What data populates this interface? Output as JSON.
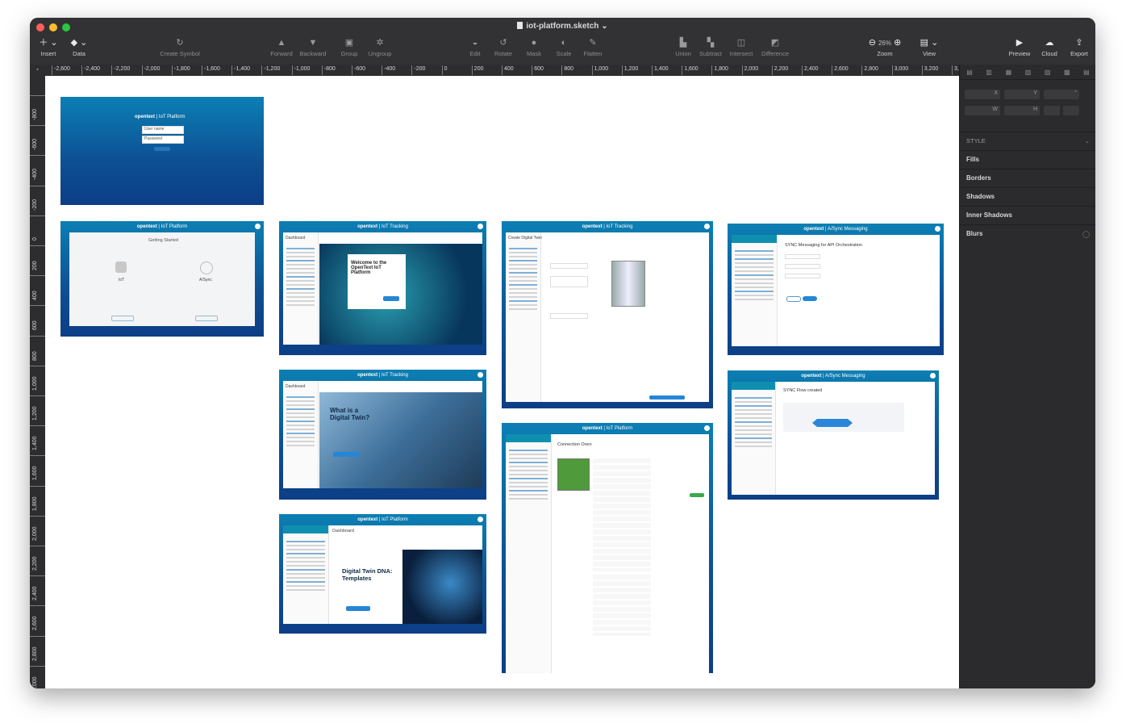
{
  "window": {
    "title": "iot-platform.sketch",
    "title_chevron": "⌄"
  },
  "toolbar": {
    "insert": "Insert",
    "data": "Data",
    "create_symbol": "Create Symbol",
    "forward": "Forward",
    "backward": "Backward",
    "group": "Group",
    "ungroup": "Ungroup",
    "edit": "Edit",
    "rotate": "Rotate",
    "mask": "Mask",
    "scale": "Scale",
    "flatten": "Flatten",
    "union": "Union",
    "subtract": "Subtract",
    "intersect": "Intersect",
    "difference": "Difference",
    "zoom": "Zoom",
    "zoom_value": "26%",
    "view": "View",
    "preview": "Preview",
    "cloud": "Cloud",
    "export": "Export"
  },
  "ruler": {
    "h_ticks": [
      "-2,600",
      "-2,400",
      "-2,200",
      "-2,000",
      "-1,800",
      "-1,600",
      "-1,400",
      "-1,200",
      "-1,000",
      "-800",
      "-600",
      "-400",
      "-200",
      "0",
      "200",
      "400",
      "600",
      "800",
      "1,000",
      "1,200",
      "1,400",
      "1,600",
      "1,800",
      "2,000",
      "2,200",
      "2,400",
      "2,600",
      "2,800",
      "3,000",
      "3,200",
      "3,40"
    ],
    "v_ticks": [
      "-800",
      "-600",
      "-400",
      "-200",
      "0",
      "200",
      "400",
      "600",
      "800",
      "1,000",
      "1,200",
      "1,400",
      "1,600",
      "1,800",
      "2,000",
      "2,200",
      "2,400",
      "2,600",
      "2,800",
      "3,000"
    ]
  },
  "inspector": {
    "x": "X",
    "y": "Y",
    "r": "°",
    "w": "W",
    "h": "H",
    "style": "STYLE",
    "fills": "Fills",
    "borders": "Borders",
    "shadows": "Shadows",
    "inner_shadows": "Inner Shadows",
    "blurs": "Blurs"
  },
  "artboards": {
    "brand": "opentext",
    "iot_platform": "IoT Platform",
    "iot_tracking": "IoT Tracking",
    "async_messaging": "A/Sync Messaging",
    "login": {
      "user": "User name",
      "password": "Password"
    },
    "getting_started": {
      "title": "Getting Started",
      "iot": "IoT",
      "async": "A/Sync"
    },
    "dashboard": "Dashboard",
    "welcome": "Welcome to the OpenText IoT Platform",
    "digital_twin": "What is a Digital Twin?",
    "dna": "Digital Twin DNA: Templates",
    "create_twin": "Create Digital Twin",
    "connection_oven": "Connection Oven",
    "sync_api": "SYNC Messaging for API Orchestration",
    "sync_flow": "SYNC Flow created"
  }
}
